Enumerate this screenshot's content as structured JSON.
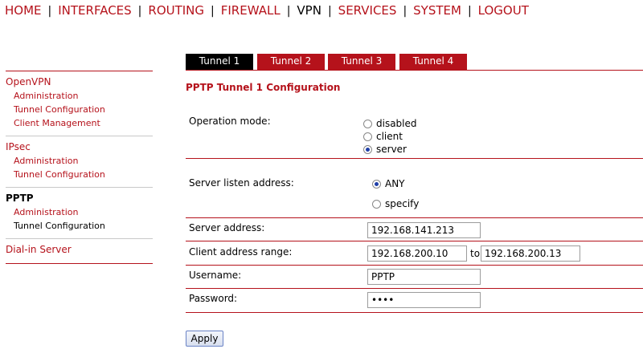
{
  "topnav": {
    "items": [
      "HOME",
      "INTERFACES",
      "ROUTING",
      "FIREWALL",
      "VPN",
      "SERVICES",
      "SYSTEM",
      "LOGOUT"
    ],
    "active": "VPN"
  },
  "sidebar": {
    "openvpn": {
      "title": "OpenVPN",
      "items": [
        "Administration",
        "Tunnel Configuration",
        "Client Management"
      ]
    },
    "ipsec": {
      "title": "IPsec",
      "items": [
        "Administration",
        "Tunnel Configuration"
      ]
    },
    "pptp": {
      "title": "PPTP",
      "items": [
        "Administration",
        "Tunnel Configuration"
      ]
    },
    "dialin": {
      "title": "Dial-in Server"
    }
  },
  "tabs": [
    "Tunnel 1",
    "Tunnel 2",
    "Tunnel 3",
    "Tunnel 4"
  ],
  "form": {
    "title": "PPTP Tunnel 1 Configuration",
    "operation_mode": {
      "label": "Operation mode:",
      "options": [
        "disabled",
        "client",
        "server"
      ],
      "selected": "server"
    },
    "listen_address": {
      "label": "Server listen address:",
      "options": [
        "ANY",
        "specify"
      ],
      "selected": "ANY"
    },
    "server_address": {
      "label": "Server address:",
      "value": "192.168.141.213"
    },
    "client_range": {
      "label": "Client address range:",
      "from": "192.168.200.10",
      "to_label": "to",
      "to": "192.168.200.13"
    },
    "username": {
      "label": "Username:",
      "value": "PPTP"
    },
    "password": {
      "label": "Password:",
      "value": "••••"
    },
    "apply_label": "Apply"
  },
  "colors": {
    "accent": "#b5121b",
    "active_tab": "#000000"
  }
}
